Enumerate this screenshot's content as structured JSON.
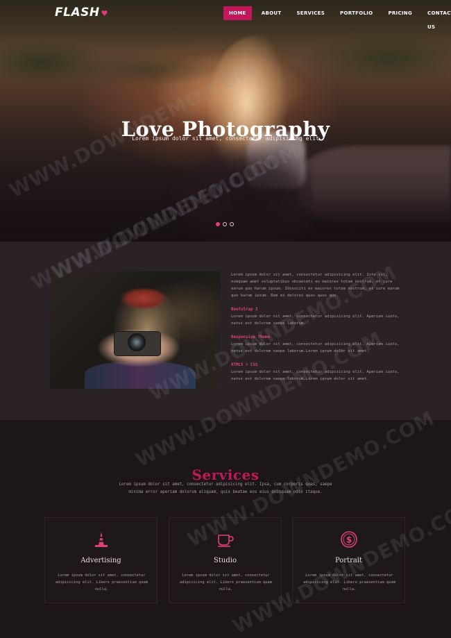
{
  "brand": {
    "logo": "FLASH",
    "heart": "♥"
  },
  "nav": {
    "items": [
      {
        "label": "HOME",
        "active": true
      },
      {
        "label": "ABOUT",
        "active": false
      },
      {
        "label": "SERVICES",
        "active": false
      },
      {
        "label": "PORTFOLIO",
        "active": false
      },
      {
        "label": "PRICING",
        "active": false
      },
      {
        "label": "CONTACT US",
        "active": false
      }
    ]
  },
  "hero": {
    "title": "Love Photography",
    "subtitle": "Lorem ipsum dolor sit amet, consectetur adipisicing elit",
    "slides": 3,
    "active_slide": 1
  },
  "about": {
    "intro": "Lorem ipsum dolor sit amet, consectetur adipisicing elit. Iste sit, numquam amet voluptatibus obcaecati ex maiores totam nostrum, et iure earum quo harum ipsum. Idcesciti ex maiores totam nostrum, et iure earum quo harum ipsum. Rem ex dolores quos quos quo.",
    "features": [
      {
        "title": "Bootstrap 3",
        "text": "Lorem ipsum dolor sit amet, consectetur adipisicing elit. Aperiam iusto, natus est dolorem saepe laborum."
      },
      {
        "title": "Responsive Theme",
        "text": "Lorem ipsum dolor sit amet, consectetur adipisicing elit. Aperiam iusto, natus est dolorem saepe laborum.Lorem ipsum dolor sit amet."
      },
      {
        "title": "HTML5 + CSS",
        "text": "Lorem ipsum dolor sit amet, consectetur adipisicing elit. Aperiam iusto, natus est dolorem saepe laborum.Lorem ipsum dolor sit amet."
      }
    ]
  },
  "services": {
    "title": "Services",
    "intro": "Lorem ipsum dolor sit amet, consectetur adipisicing elit. Ipsa, cum corporis quas, saepe minima error aperiam dolorum aliquam, quis beatae eos eius quisquam odio itaque.",
    "cards": [
      {
        "icon": "traffic-cone-icon",
        "title": "Advertising",
        "text": "Lorem ipsum dolor sit amet, consectetur adipisicing elit. Libero praesentium quam nulla."
      },
      {
        "icon": "coffee-cup-icon",
        "title": "Studio",
        "text": "Lorem ipsum dolor sit amet, consectetur adipisicing elit. Libero praesentium quam nulla."
      },
      {
        "icon": "dollar-coin-icon",
        "title": "Portrait",
        "text": "Lorem ipsum dolor sit amet, consectetur adipisicing elit. Libero praesentium quam nulla."
      }
    ]
  },
  "watermark": "WWW.DOWNDEMO.COM",
  "colors": {
    "accent": "#c2185b",
    "pink": "#e0407a",
    "bg_dark": "#1c1619",
    "bg_about": "#2a2226"
  }
}
